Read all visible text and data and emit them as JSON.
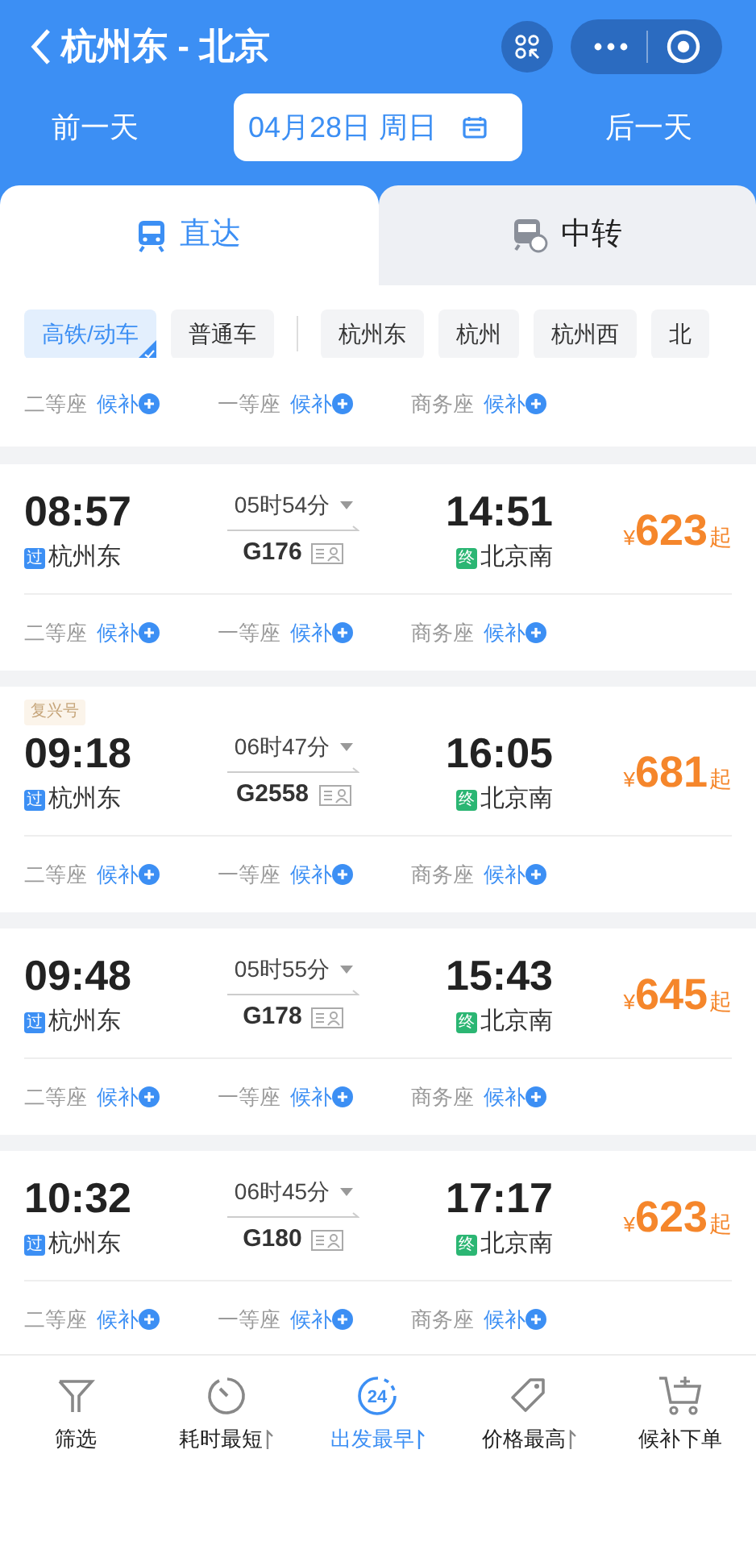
{
  "header": {
    "title": "杭州东 - 北京",
    "prev_day": "前一天",
    "date": "04月28日 周日",
    "next_day": "后一天"
  },
  "tabs": [
    {
      "label": "直达",
      "selected": true
    },
    {
      "label": "中转",
      "selected": false
    }
  ],
  "filters": {
    "train_types": [
      {
        "label": "高铁/动车",
        "selected": true
      },
      {
        "label": "普通车",
        "selected": false
      }
    ],
    "stations": [
      {
        "label": "杭州东",
        "selected": false
      },
      {
        "label": "杭州",
        "selected": false
      },
      {
        "label": "杭州西",
        "selected": false
      },
      {
        "label": "北",
        "selected": false
      }
    ]
  },
  "partial_seats": [
    {
      "class": "二等座",
      "status": "候补"
    },
    {
      "class": "一等座",
      "status": "候补"
    },
    {
      "class": "商务座",
      "status": "候补"
    }
  ],
  "trains": [
    {
      "depart": "08:57",
      "from_tag": "过",
      "from": "杭州东",
      "duration": "05时54分",
      "train_no": "G176",
      "arrive": "14:51",
      "to_tag": "终",
      "to": "北京南",
      "currency": "¥",
      "price": "623",
      "price_suffix": "起",
      "seats": [
        {
          "class": "二等座",
          "status": "候补"
        },
        {
          "class": "一等座",
          "status": "候补"
        },
        {
          "class": "商务座",
          "status": "候补"
        }
      ]
    },
    {
      "badge": "复兴号",
      "depart": "09:18",
      "from_tag": "过",
      "from": "杭州东",
      "duration": "06时47分",
      "train_no": "G2558",
      "arrive": "16:05",
      "to_tag": "终",
      "to": "北京南",
      "currency": "¥",
      "price": "681",
      "price_suffix": "起",
      "seats": [
        {
          "class": "二等座",
          "status": "候补"
        },
        {
          "class": "一等座",
          "status": "候补"
        },
        {
          "class": "商务座",
          "status": "候补"
        }
      ]
    },
    {
      "depart": "09:48",
      "from_tag": "过",
      "from": "杭州东",
      "duration": "05时55分",
      "train_no": "G178",
      "arrive": "15:43",
      "to_tag": "终",
      "to": "北京南",
      "currency": "¥",
      "price": "645",
      "price_suffix": "起",
      "seats": [
        {
          "class": "二等座",
          "status": "候补"
        },
        {
          "class": "一等座",
          "status": "候补"
        },
        {
          "class": "商务座",
          "status": "候补"
        }
      ]
    },
    {
      "depart": "10:32",
      "from_tag": "过",
      "from": "杭州东",
      "duration": "06时45分",
      "train_no": "G180",
      "arrive": "17:17",
      "to_tag": "终",
      "to": "北京南",
      "currency": "¥",
      "price": "623",
      "price_suffix": "起",
      "seats": [
        {
          "class": "二等座",
          "status": "候补"
        },
        {
          "class": "一等座",
          "status": "候补"
        },
        {
          "class": "商务座",
          "status": "候补"
        }
      ]
    }
  ],
  "bottom_bar": [
    {
      "label": "筛选",
      "selected": false,
      "sortable": false
    },
    {
      "label": "耗时最短",
      "selected": false,
      "sortable": true
    },
    {
      "label": "出发最早",
      "selected": true,
      "sortable": true,
      "icon_text": "24"
    },
    {
      "label": "价格最高",
      "selected": false,
      "sortable": true
    },
    {
      "label": "候补下单",
      "selected": false,
      "sortable": false
    }
  ]
}
